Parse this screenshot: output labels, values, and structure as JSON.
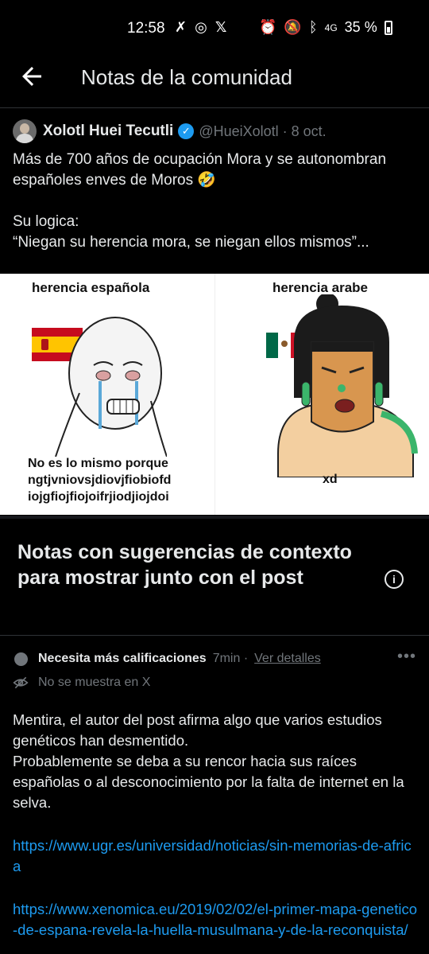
{
  "status_bar": {
    "time": "12:58",
    "battery": "35 %",
    "network": "4G"
  },
  "header": {
    "back_icon": "arrow-left-icon",
    "title": "Notas de la comunidad"
  },
  "post": {
    "author_name": "Xolotl Huei Tecutli",
    "author_handle": "@HueiXolotl · 8 oct.",
    "text": "Más de 700 años de ocupación Mora y se autonombran españoles enves de Moros 🤣\n\nSu logica:\n“Niegan su herencia mora, se niegan ellos mismos”...",
    "image": {
      "label_left": "herencia española",
      "label_right": "herencia arabe",
      "caption_left": "No es lo mismo porque\nngtjvniovsjdiovjfiobiofd\niojgfiojfiojoifrjiodjiojdoi",
      "caption_right": "xd"
    }
  },
  "notes_section": {
    "title": "Notas con sugerencias de contexto para mostrar junto con el post"
  },
  "note": {
    "status": "Necesita más calificaciones",
    "time": "7min ·",
    "details_link": "Ver detalles",
    "visibility": "No se muestra en X",
    "body": "Mentira, el autor del post afirma algo que varios estudios genéticos han desmentido.\nProbablemente se deba a su rencor hacia sus raíces españolas o al desconocimiento por la falta de internet en la selva.",
    "link1": "https://www.ugr.es/universidad/noticias/sin-memorias-de-africa",
    "link2": "https://www.xenomica.eu/2019/02/02/el-primer-mapa-genetico-de-espana-revela-la-huella-musulmana-y-de-la-reconquista/"
  },
  "colors": {
    "background": "#000000",
    "text": "#e7e9ea",
    "muted": "#71767b",
    "link": "#1d9bf0",
    "verified": "#1d9bf0"
  }
}
